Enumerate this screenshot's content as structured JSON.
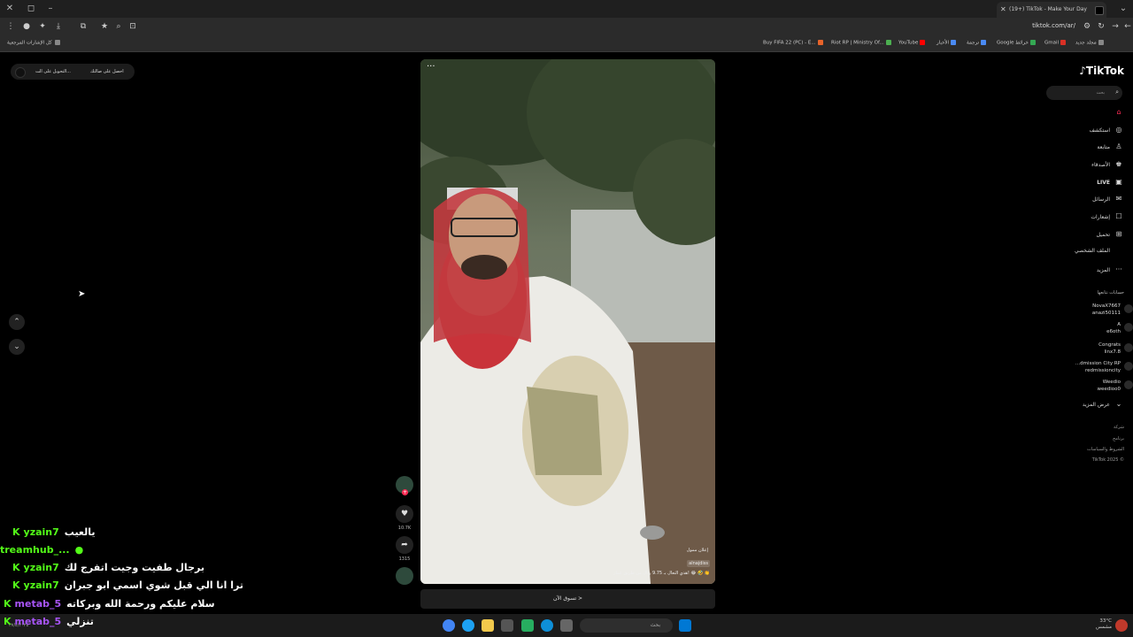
{
  "browser": {
    "tab_title": "(19+) TikTok - Make Your Day",
    "new_tab": "+",
    "url": "tiktok.com/ar/",
    "bookmarks": [
      {
        "label": "Buy FIFA 22 (PC) - E...",
        "color": "#e8642a"
      },
      {
        "label": "Riot RP | Ministry Of...",
        "color": "#4caf50"
      },
      {
        "label": "YouTube",
        "color": "#ff0000"
      },
      {
        "label": "الأخبار",
        "color": "#4a8af4"
      },
      {
        "label": "ترجمة",
        "color": "#4a8af4"
      },
      {
        "label": "Google خرائط",
        "color": "#34a853"
      },
      {
        "label": "Gmail",
        "color": "#d93025"
      },
      {
        "label": "مجلد جديد",
        "color": "#888888"
      }
    ],
    "all_bookmarks": "كل الإشارات المرجعية"
  },
  "pill": {
    "item1": "احصل على صالتك",
    "item2": "التحويل على الت..."
  },
  "video": {
    "menu": "···",
    "ad_label": "إعلان ممول",
    "author": "alnajdiss",
    "caption": "هذي النعال بـ 9.75 ريال من طريق عمار! 😂 🤣 👏",
    "shop": "تسوق الآن >"
  },
  "actions": {
    "likes": "10.7K",
    "shares": "1315"
  },
  "sidebar": {
    "logo": "TikTok",
    "search_placeholder": "بحث",
    "nav": [
      {
        "label": "",
        "icon": "home-icon",
        "glyph": "⌂",
        "active": true
      },
      {
        "label": "استكشف",
        "icon": "compass-icon",
        "glyph": "◎"
      },
      {
        "label": "متابعة",
        "icon": "following-icon",
        "glyph": "♙"
      },
      {
        "label": "الأصدقاء",
        "icon": "friends-icon",
        "glyph": "♚"
      },
      {
        "label": "LIVE",
        "icon": "live-icon",
        "glyph": "▣"
      },
      {
        "label": "الرسائل",
        "icon": "messages-icon",
        "glyph": "✉"
      },
      {
        "label": "إشعارات",
        "icon": "notifications-icon",
        "glyph": "☐"
      },
      {
        "label": "تحميل",
        "icon": "upload-icon",
        "glyph": "⊞"
      },
      {
        "label": "الملف الشخصي",
        "icon": "profile-icon",
        "glyph": ""
      },
      {
        "label": "المزيد",
        "icon": "more-icon",
        "glyph": "···"
      }
    ],
    "following_header": "حسابات تتابعها",
    "following": [
      {
        "name": "NovaX7667",
        "handle": "anazi50111"
      },
      {
        "name": "A",
        "handle": "e6oth"
      },
      {
        "name": "Congrats",
        "handle": "linx7.8"
      },
      {
        "name": "...dmission City RP",
        "handle": "redmissioncity"
      },
      {
        "name": "Weedio",
        "handle": "weedioo0"
      }
    ],
    "show_more": "عرض المزيد",
    "footer": [
      "شركة",
      "برنامج",
      "الشروط والسياسات",
      "TikTok 2025 ©"
    ]
  },
  "chat": [
    {
      "user": "yzain7",
      "color": "#53fc18",
      "msg": "يالعيب",
      "badge": true
    },
    {
      "user": "treamhub_...",
      "color": "#53fc18",
      "msg": "",
      "badge": false
    },
    {
      "user": "yzain7",
      "color": "#53fc18",
      "msg": "برجال طفيت وجيت اتفرج لك",
      "badge": true
    },
    {
      "user": "yzain7",
      "color": "#53fc18",
      "msg": "ترا انا الي قبل شوي اسمي ابو جبران",
      "badge": true
    },
    {
      "user": "metab_5",
      "color": "#a855f7",
      "msg": "سلام عليكم ورحمة الله وبركاته",
      "badge": true
    },
    {
      "user": "metab_5",
      "color": "#a855f7",
      "msg": "تنزلي",
      "badge": true
    }
  ],
  "taskbar": {
    "search": "بحث",
    "temp": "33°C",
    "weather": "مشمس",
    "date": "٢٧/٤/٢٠٢٥"
  }
}
